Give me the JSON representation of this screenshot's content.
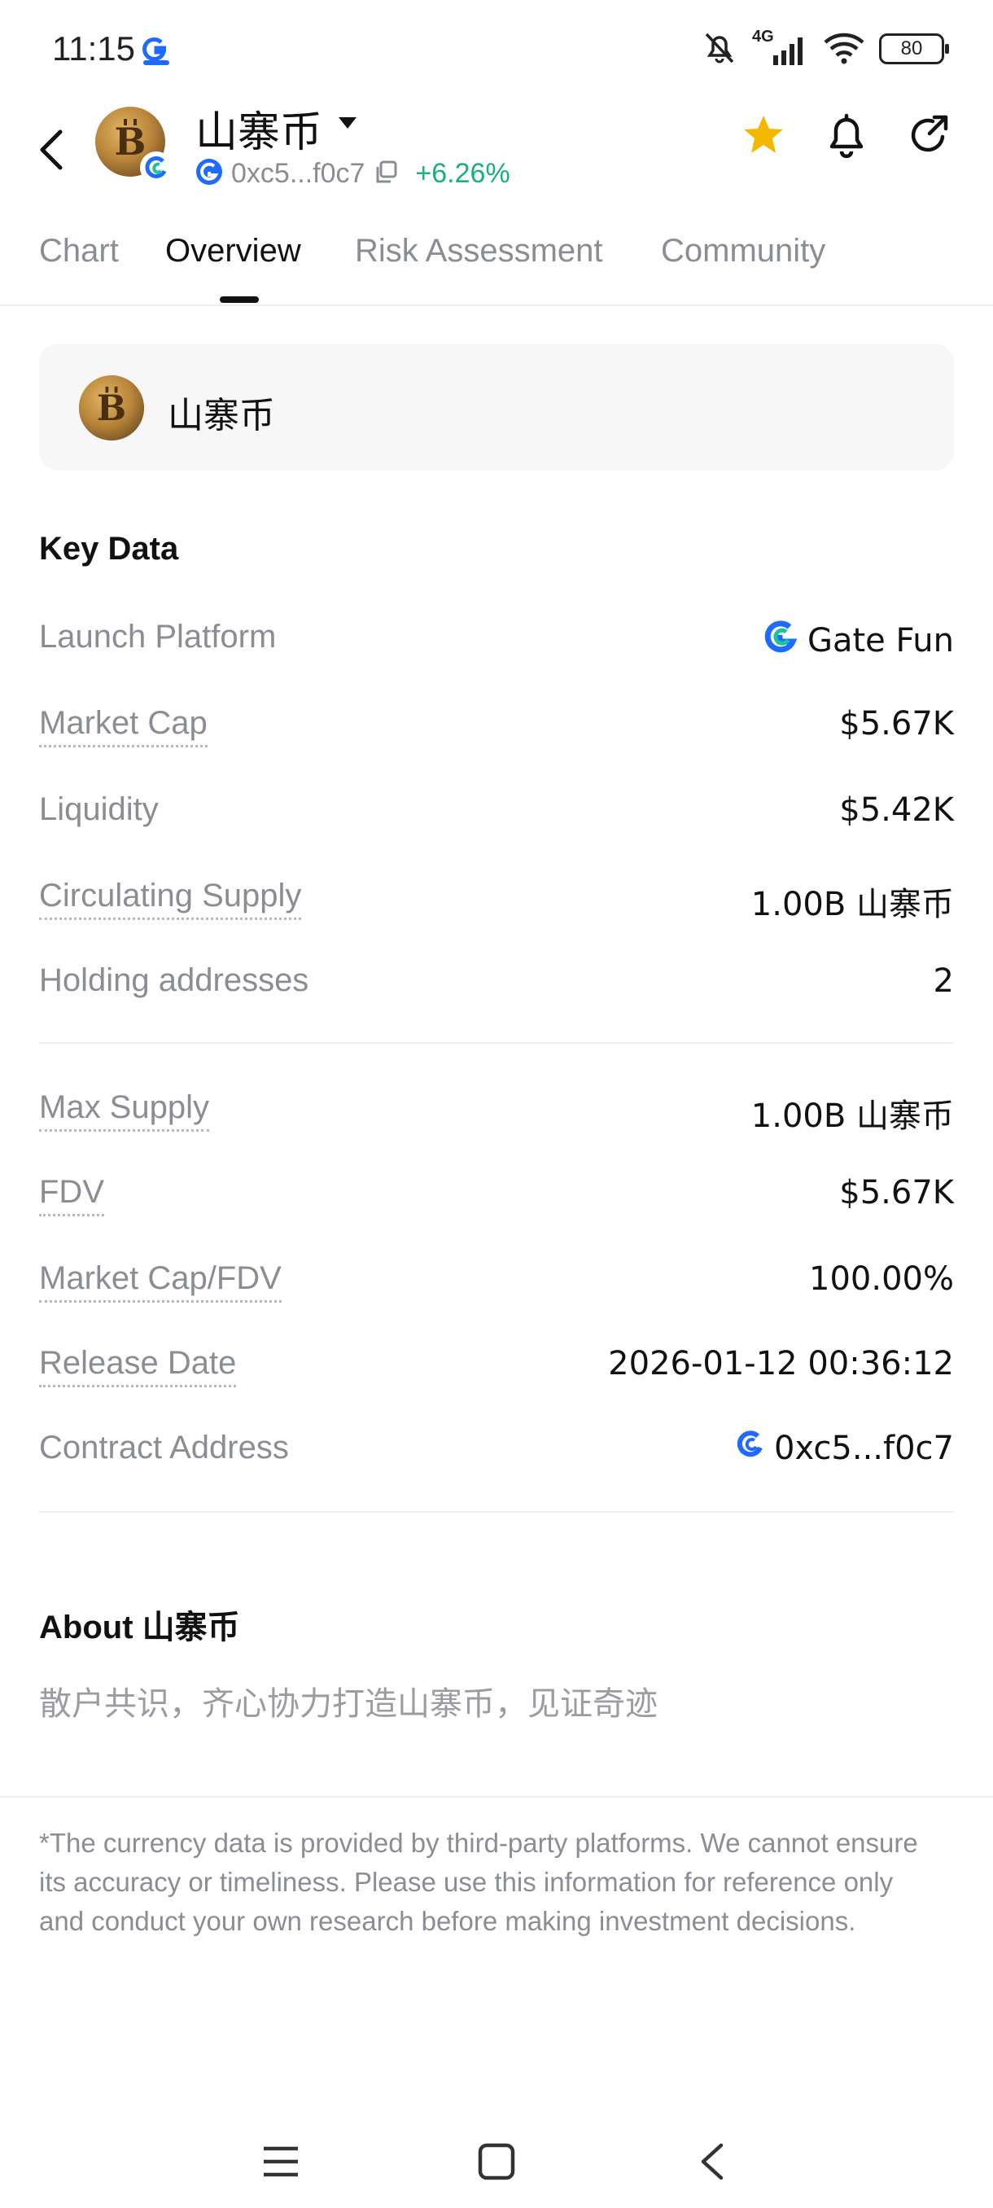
{
  "status_bar": {
    "time": "11:15",
    "network": "4G",
    "battery": "80"
  },
  "header": {
    "token_name": "山寨币",
    "address_short": "0xc5...f0c7",
    "change": "+6.26%",
    "change_color": "#19b07a",
    "favorite_color": "#f5b800"
  },
  "tabs": [
    {
      "label": "Chart"
    },
    {
      "label": "Overview"
    },
    {
      "label": "Risk Assessment"
    },
    {
      "label": "Community"
    }
  ],
  "token_card": {
    "name": "山寨币"
  },
  "key_data": {
    "title": "Key Data",
    "launch_platform_label": "Launch Platform",
    "launch_platform_value": "Gate Fun",
    "market_cap_label": "Market Cap",
    "market_cap_value": "$5.67K",
    "liquidity_label": "Liquidity",
    "liquidity_value": "$5.42K",
    "circulating_supply_label": "Circulating Supply",
    "circulating_supply_value": "1.00B 山寨币",
    "holding_addresses_label": "Holding addresses",
    "holding_addresses_value": "2",
    "max_supply_label": "Max Supply",
    "max_supply_value": "1.00B 山寨币",
    "fdv_label": "FDV",
    "fdv_value": "$5.67K",
    "mcap_fdv_label": "Market Cap/FDV",
    "mcap_fdv_value": "100.00%",
    "release_date_label": "Release Date",
    "release_date_value": "2026-01-12 00:36:12",
    "contract_address_label": "Contract Address",
    "contract_address_value": "0xc5...f0c7"
  },
  "about": {
    "title": "About 山寨币",
    "text": "散户共识，齐心协力打造山寨币，见证奇迹"
  },
  "disclaimer": "*The currency data is provided by third-party platforms. We cannot ensure its accuracy or timeliness. Please use this information for reference only and conduct your own research before making investment decisions.",
  "icons": {
    "brand_blue": "#1f6bff",
    "brand_green": "#19c2a0"
  }
}
